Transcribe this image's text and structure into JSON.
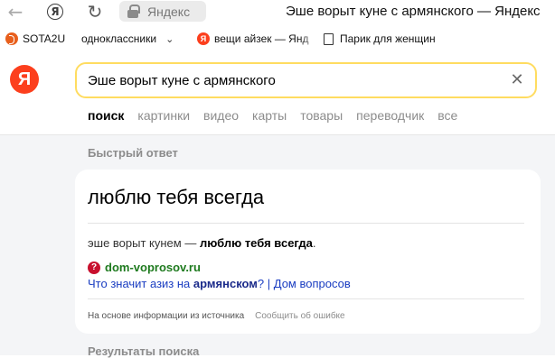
{
  "browser": {
    "address_text": "Яндекс",
    "page_title": "Эше ворыт куне с армянского — Яндекс",
    "icons": {
      "back": "back-arrow-icon",
      "home": "yandex-browser-icon",
      "reload": "reload-icon",
      "lock": "lock-icon"
    }
  },
  "bookmarks": [
    {
      "label": "SOTA2U",
      "icon": "sota-icon"
    },
    {
      "label": "одноклассники",
      "icon": "chevron-down-icon"
    },
    {
      "label": "вещи айзек — Янд",
      "icon": "yandex-icon"
    },
    {
      "label": "Парик для женщин",
      "icon": "document-icon"
    }
  ],
  "search": {
    "logo": "Я",
    "query": "Эше ворыт куне с армянского",
    "tabs": [
      "поиск",
      "картинки",
      "видео",
      "карты",
      "товары",
      "переводчик",
      "все"
    ],
    "active_tab": "поиск"
  },
  "quick_answer": {
    "section_label": "Быстрый ответ",
    "title": "люблю тебя всегда",
    "text_prefix": "эше ворыт кунем — ",
    "text_bold": "люблю тебя всегда",
    "text_suffix": ".",
    "source_domain": "dom-voprosov.ru",
    "source_icon": "question-icon",
    "link_prefix": "Что значит азиз на ",
    "link_bold": "армянском",
    "link_suffix": "? | Дом вопросов",
    "footer_source": "На основе информации из источника",
    "footer_report": "Сообщить об ошибке"
  },
  "results": {
    "section_label": "Результаты поиска"
  },
  "colors": {
    "brand_red": "#fc3f1d",
    "search_border": "#ffdc60",
    "link_blue": "#1a3dc1",
    "domain_green": "#1e7a1e",
    "page_bg": "#f4f5f7"
  }
}
